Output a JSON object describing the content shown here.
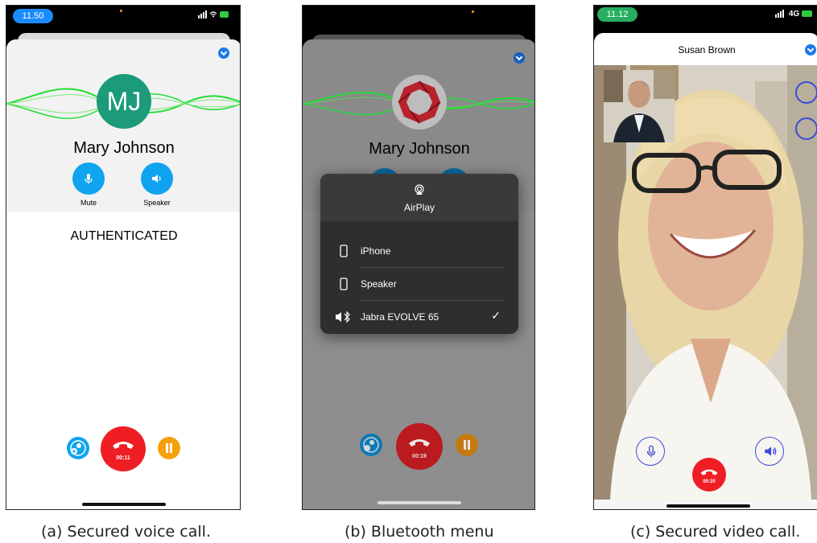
{
  "panel_a": {
    "status_time": "11.50",
    "avatar_initials": "MJ",
    "caller_name": "Mary Johnson",
    "buttons": {
      "mute": "Mute",
      "speaker": "Speaker"
    },
    "status_text": "AUTHENTICATED",
    "call_timer": "00:11",
    "caption": "(a) Secured voice call."
  },
  "panel_b": {
    "caller_name": "Mary Johnson",
    "menu_title": "AirPlay",
    "menu_items": [
      "iPhone",
      "Speaker",
      "Jabra EVOLVE 65"
    ],
    "selected_item": "Jabra EVOLVE 65",
    "call_timer": "00:19",
    "caption": "(b) Bluetooth menu"
  },
  "panel_c": {
    "status_time": "11.12",
    "network": "4G",
    "contact_name": "Susan Brown",
    "call_timer": "00:20",
    "caption": "(c) Secured video call."
  },
  "colors": {
    "accent_blue": "#10a4f0",
    "end_call_red": "#ef1e25",
    "hold_orange": "#f5a00c",
    "avatar_green": "#1b9b7a",
    "wave_green": "#22dd33"
  }
}
